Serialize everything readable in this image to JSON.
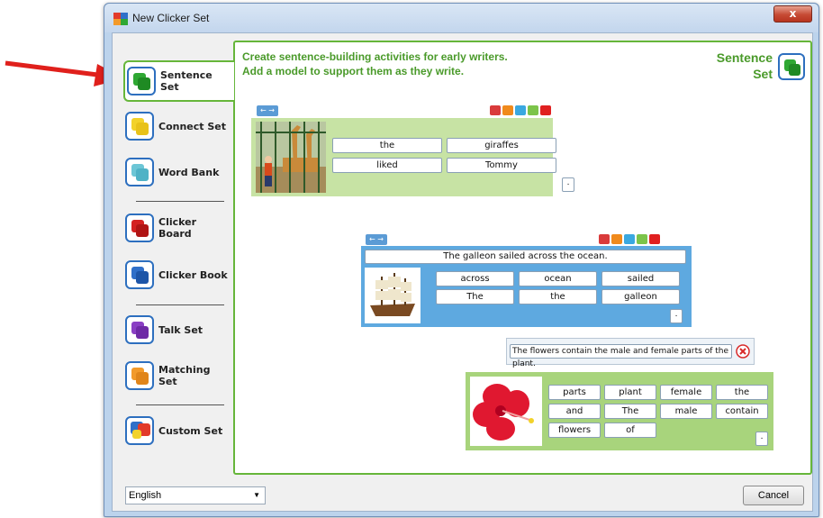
{
  "window": {
    "title": "New Clicker Set",
    "close_label": "x"
  },
  "sidebar": {
    "items": [
      {
        "label": "Sentence Set",
        "color": "#2fa833",
        "icon": "sentence-set-icon"
      },
      {
        "label": "Connect Set",
        "color": "#f2d22a",
        "icon": "connect-set-icon"
      },
      {
        "label": "Word Bank",
        "color": "#6cc6d6",
        "icon": "word-bank-icon"
      },
      {
        "label": "Clicker Board",
        "color": "#d42121",
        "icon": "clicker-board-icon"
      },
      {
        "label": "Clicker Book",
        "color": "#2f6fc9",
        "icon": "clicker-book-icon"
      },
      {
        "label": "Talk Set",
        "color": "#8a3fc4",
        "icon": "talk-set-icon"
      },
      {
        "label": "Matching Set",
        "color": "#f29a2a",
        "icon": "matching-set-icon"
      },
      {
        "label": "Custom Set",
        "color": "#e23a2a",
        "icon": "custom-set-icon"
      }
    ]
  },
  "main": {
    "description_line1": "Create sentence-building activities for early writers.",
    "description_line2": "Add a model to support them as they write.",
    "heading_line1": "Sentence",
    "heading_line2": "Set",
    "accent": "#4a9a2a"
  },
  "examples": {
    "giraffes": {
      "words": [
        "the",
        "giraffes",
        "liked",
        "Tommy"
      ]
    },
    "galleon": {
      "sentence": "The galleon sailed across the ocean.",
      "words": [
        "across",
        "ocean",
        "sailed",
        "The",
        "the",
        "galleon"
      ]
    },
    "flowers": {
      "sentence": "The flowers contain the male and female parts of the plant.",
      "words": [
        "parts",
        "plant",
        "female",
        "the",
        "and",
        "The",
        "male",
        "contain",
        "flowers",
        "of"
      ]
    },
    "more_label": ".",
    "prev_next": "← →"
  },
  "footer": {
    "language": "English",
    "cancel_label": "Cancel"
  },
  "colors": {
    "panel_green": "#66b63a",
    "card_green": "#c7e3a4",
    "card_blue": "#5ea9e0",
    "annotation_arrow": "#e0201c"
  }
}
